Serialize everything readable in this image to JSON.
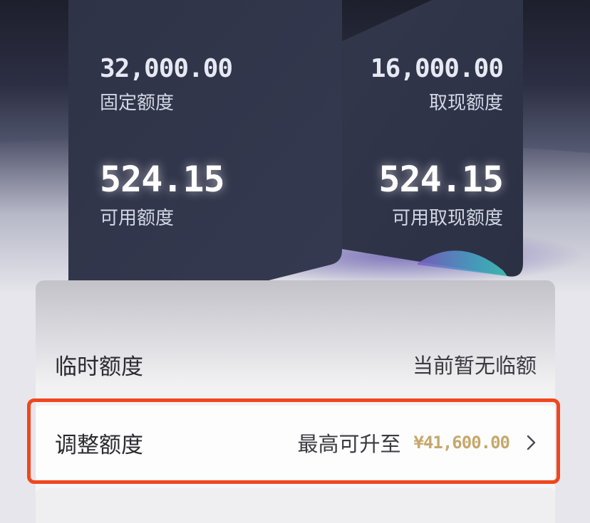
{
  "cards": {
    "fixed": {
      "amount": "32,000.00",
      "label": "固定额度",
      "available_amount": "524.15",
      "available_label": "可用额度"
    },
    "cash": {
      "amount": "16,000.00",
      "label": "取现额度",
      "available_amount": "524.15",
      "available_label": "可用取现额度"
    }
  },
  "rows": {
    "temporary": {
      "label": "临时额度",
      "value": "当前暂无临额"
    },
    "adjust": {
      "label": "调整额度",
      "prefix": "最高可升至",
      "amount": "¥41,600.00",
      "icon": "chevron-right-icon"
    }
  },
  "colors": {
    "card": "#31354a",
    "gold_amount": "#c6a86c",
    "highlight_border": "#f0461e"
  }
}
